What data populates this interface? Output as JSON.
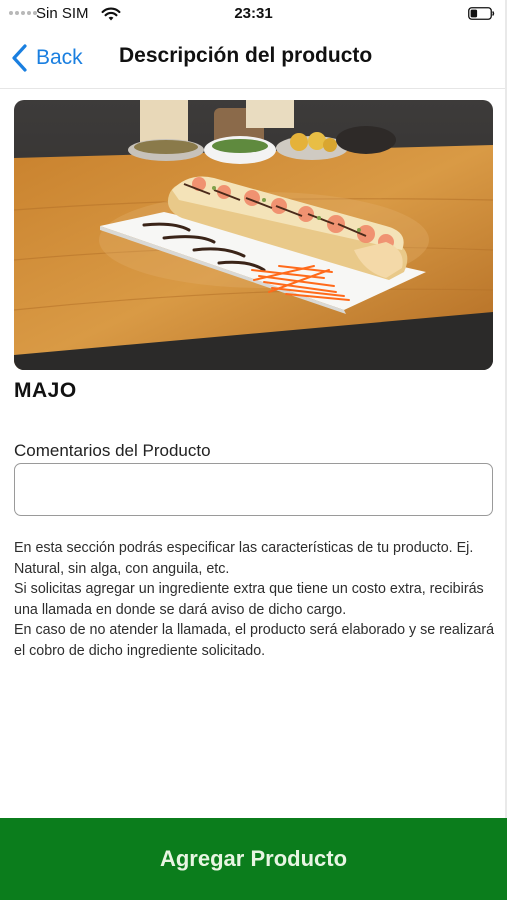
{
  "status_bar": {
    "carrier": "Sin SIM",
    "time": "23:31",
    "icons": [
      "signal-dots-icon",
      "wifi-icon",
      "battery-icon"
    ]
  },
  "nav": {
    "back_label": "Back",
    "back_icon": "chevron-left-icon",
    "title": "Descripción del producto"
  },
  "product": {
    "name": "MAJO"
  },
  "comments": {
    "label": "Comentarios del Producto",
    "value": "",
    "placeholder": ""
  },
  "info": {
    "paragraphs": [
      "En esta sección podrás especificar las características de tu producto. Ej. Natural, sin alga, con anguila, etc.",
      "Si solicitas agregar un ingrediente extra que tiene un costo extra, recibirás una llamada en donde se dará aviso de dicho cargo.",
      "En caso de no atender la llamada, el producto será elaborado y se realizará el cobro de dicho ingrediente solicitado."
    ]
  },
  "add_button": {
    "label": "Agregar Producto"
  },
  "colors": {
    "accent": "#1a7fe0",
    "button_bg": "#0b7d1c",
    "button_text": "#e8f5e2"
  }
}
